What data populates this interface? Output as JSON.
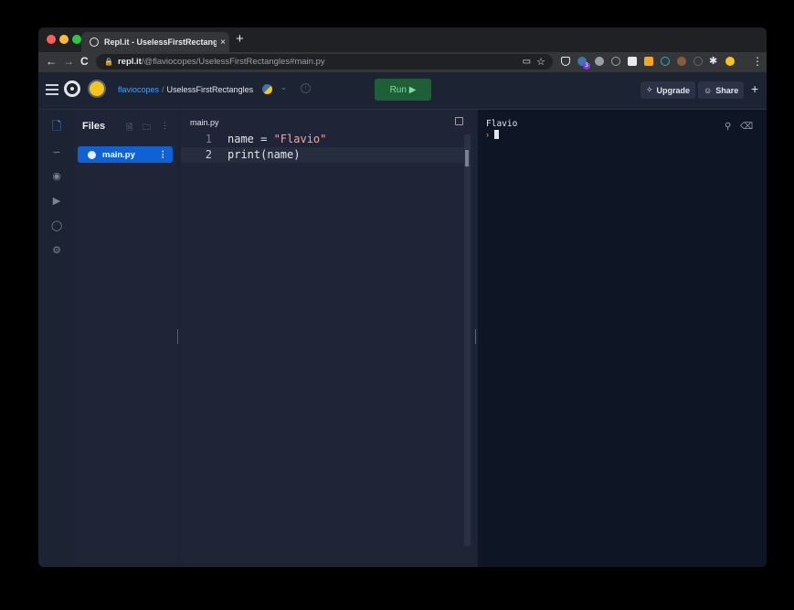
{
  "browser": {
    "tab_title": "Repl.it - UselessFirstRectangles",
    "tab_close": "×",
    "new_tab": "+",
    "url_host": "repl.it",
    "url_path": "/@flaviocopes/UselessFirstRectangles#main.py",
    "nav_back": "←",
    "nav_forward": "→",
    "nav_reload": "C",
    "menu": "⋮",
    "traffic_colors": [
      "#ff5f57",
      "#febc2e",
      "#28c840"
    ],
    "extension_badge": "3"
  },
  "header": {
    "user": "flaviocopes",
    "separator": "/",
    "project": "UselessFirstRectangles",
    "caret": "⌄",
    "info": "i",
    "run_label": "Run ▶",
    "upgrade_label": "Upgrade",
    "share_label": "Share",
    "plus_label": "+"
  },
  "sidebar": {
    "help_label": "?"
  },
  "files": {
    "title": "Files",
    "items": [
      {
        "name": "main.py",
        "menu": "⋮"
      }
    ]
  },
  "editor": {
    "tab_label": "main.py",
    "lines": [
      {
        "number": "1",
        "code_pre": "name = ",
        "code_str": "\"Flavio\"",
        "code_post": ""
      },
      {
        "number": "2",
        "code_pre": "print(name)",
        "code_str": "",
        "code_post": ""
      }
    ]
  },
  "console": {
    "output": "Flavio",
    "prompt": "›"
  },
  "colors": {
    "accent_blue": "#0f62d6",
    "run_green": "#1f5f38",
    "string_color": "#f4a59e",
    "background": "#1c2333"
  }
}
